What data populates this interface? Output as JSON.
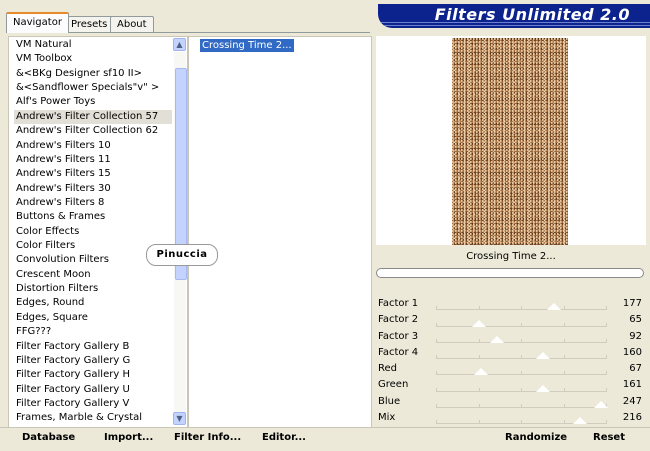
{
  "tabs": [
    "Navigator",
    "Presets",
    "About"
  ],
  "banner_title": "Filters Unlimited 2.0",
  "categories": [
    "VM Natural",
    "VM Toolbox",
    "&<BKg Designer sf10 II>",
    "&<Sandflower Specials\"v\" >",
    "Alf's Power Toys",
    "Andrew's Filter Collection 57",
    "Andrew's Filter Collection 62",
    "Andrew's Filters 10",
    "Andrew's Filters 11",
    "Andrew's Filters 15",
    "Andrew's Filters 30",
    "Andrew's Filters 8",
    "Buttons & Frames",
    "Color Effects",
    "Color Filters",
    "Convolution Filters",
    "Crescent Moon",
    "Distortion Filters",
    "Edges, Round",
    "Edges, Square",
    "FFG???",
    "Filter Factory Gallery B",
    "Filter Factory Gallery G",
    "Filter Factory Gallery H",
    "Filter Factory Gallery U",
    "Filter Factory Gallery V",
    "Frames, Marble & Crystal"
  ],
  "selected_category": "Andrew's Filter Collection 57",
  "effects": [
    "Crossing Time 2..."
  ],
  "watermark": "Pinuccia",
  "preview_name": "Crossing Time 2...",
  "params": [
    {
      "label": "Factor 1",
      "value": "177",
      "level": 177
    },
    {
      "label": "Factor 2",
      "value": "65",
      "level": 65
    },
    {
      "label": "Factor 3",
      "value": "92",
      "level": 92
    },
    {
      "label": "Factor 4",
      "value": "160",
      "level": 160
    },
    {
      "label": "Red",
      "value": "67",
      "level": 67
    },
    {
      "label": "Green",
      "value": "161",
      "level": 161
    },
    {
      "label": "Blue",
      "value": "247",
      "level": 247
    },
    {
      "label": "Mix",
      "value": "216",
      "level": 216
    }
  ],
  "buttons": {
    "database": "Database",
    "import": "Import...",
    "filter_info": "Filter Info...",
    "editor": "Editor...",
    "randomize": "Randomize",
    "reset": "Reset"
  },
  "colors": {
    "banner": "#0c238d",
    "selection": "#316ac5",
    "accent_tab": "#e68b2c"
  }
}
